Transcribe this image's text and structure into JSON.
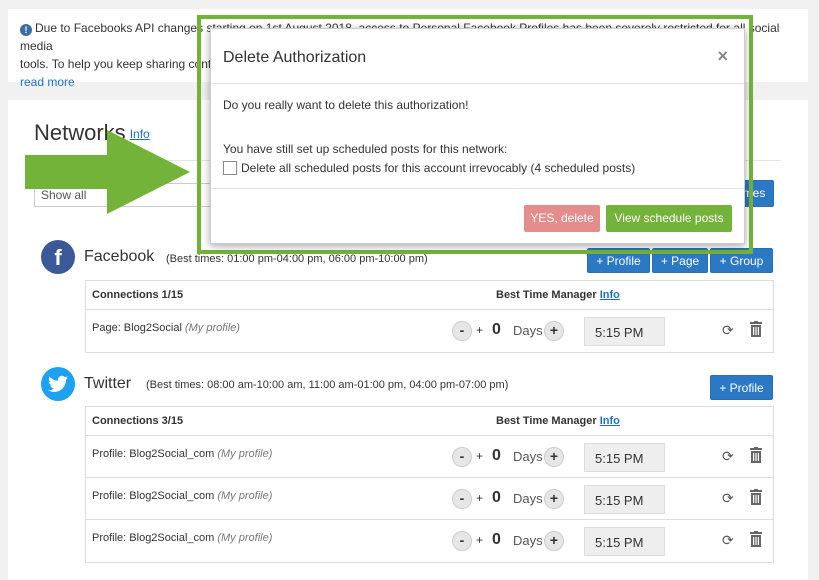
{
  "notice": {
    "text_line1": "Due to Facebooks API changes starting on 1st August 2018, access to Personal Facebook Profiles has been severely restricted for all social media",
    "text_line2": "tools. To help you keep sharing content … app.",
    "link": "read more"
  },
  "networks": {
    "title": "Networks",
    "info_link": "Info",
    "filter_value": "Show all",
    "top_button": "mes"
  },
  "facebook": {
    "name": "Facebook",
    "best_times": "(Best times: 01:00 pm-04:00 pm, 06:00 pm-10:00 pm)",
    "buttons": [
      "+ Profile",
      "+ Page",
      "+ Group"
    ],
    "connections_header": "Connections 1/15",
    "btm_header": "Best Time Manager",
    "btm_info": "Info",
    "rows": [
      {
        "label": "Page: Blog2Social",
        "sub": "(My profile)",
        "num": "0",
        "days": "Days",
        "time": "5:15 PM"
      }
    ]
  },
  "twitter": {
    "name": "Twitter",
    "best_times": "(Best times: 08:00 am-10:00 am, 11:00 am-01:00 pm, 04:00 pm-07:00 pm)",
    "buttons": [
      "+ Profile"
    ],
    "connections_header": "Connections 3/15",
    "btm_header": "Best Time Manager",
    "btm_info": "Info",
    "rows": [
      {
        "label": "Profile: Blog2Social_com",
        "sub": "(My profile)",
        "num": "0",
        "days": "Days",
        "time": "5:15 PM"
      },
      {
        "label": "Profile: Blog2Social_com",
        "sub": "(My profile)",
        "num": "0",
        "days": "Days",
        "time": "5:15 PM"
      },
      {
        "label": "Profile: Blog2Social_com",
        "sub": "(My profile)",
        "num": "0",
        "days": "Days",
        "time": "5:15 PM"
      }
    ]
  },
  "modal": {
    "title": "Delete Authorization",
    "close": "×",
    "question": "Do you really want to delete this authorization!",
    "scheduled_note": "You have still set up scheduled posts for this network:",
    "checkbox_label": "Delete all scheduled posts for this account irrevocably (4 scheduled posts)",
    "btn_delete": "YES, delete",
    "btn_view": "View schedule posts"
  },
  "colors": {
    "accent_green": "#74b339",
    "primary_blue": "#2b78c5",
    "danger_light": "#e58c8c",
    "facebook": "#3b5998",
    "twitter": "#1da1f2"
  }
}
